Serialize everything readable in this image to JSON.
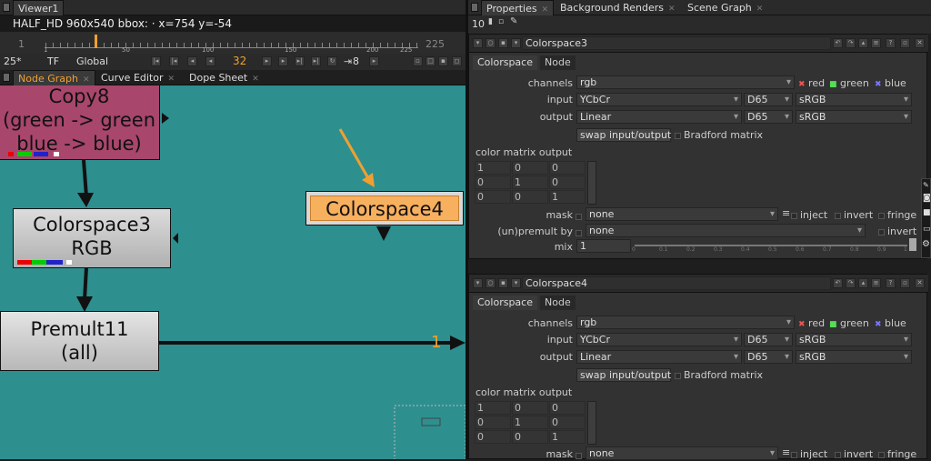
{
  "viewer": {
    "tab": "Viewer1",
    "info": "HALF_HD 960x540  bbox: · x=754 y=-54",
    "frame_start": "1",
    "frame_end": "225",
    "current_frame": "32",
    "ruler_ticks": [
      "1",
      "50",
      "100",
      "150",
      "200",
      "225"
    ],
    "zoom": "25*",
    "tf": "TF",
    "global": "Global",
    "step": "8"
  },
  "graph_tabs": [
    "Node Graph",
    "Curve Editor",
    "Dope Sheet"
  ],
  "nodes": {
    "copy8": {
      "line1": "Copy8",
      "line2": "(green -> green",
      "line3": "blue -> blue)"
    },
    "colorspace3": {
      "line1": "Colorspace3",
      "line2": "RGB"
    },
    "colorspace4": {
      "line1": "Colorspace4"
    },
    "premult11": {
      "line1": "Premult11",
      "line2": "(all)"
    }
  },
  "pipe_number": "1",
  "right_tabs": [
    "Properties",
    "Background Renders",
    "Scene Graph"
  ],
  "props_count": "10",
  "panels": [
    {
      "title": "Colorspace3",
      "subtabs": [
        "Colorspace",
        "Node"
      ],
      "channels_label": "channels",
      "channels_value": "rgb",
      "channel_flags": [
        "red",
        "green",
        "blue"
      ],
      "input_label": "input",
      "input_values": [
        "YCbCr",
        "D65",
        "sRGB"
      ],
      "output_label": "output",
      "output_values": [
        "Linear",
        "D65",
        "sRGB"
      ],
      "swap_button": "swap input/output",
      "bradford": "Bradford matrix",
      "matrix_label": "color matrix output",
      "matrix": [
        [
          "1",
          "0",
          "0"
        ],
        [
          "0",
          "1",
          "0"
        ],
        [
          "0",
          "0",
          "1"
        ]
      ],
      "mask_label": "mask",
      "mask_value": "none",
      "inject": "inject",
      "invert": "invert",
      "fringe": "fringe",
      "premult_label": "(un)premult by",
      "premult_value": "none",
      "premult_invert": "invert",
      "mix_label": "mix",
      "mix_value": "1",
      "mix_ticks": [
        "0",
        "0.1",
        "0.2",
        "0.3",
        "0.4",
        "0.5",
        "0.6",
        "0.7",
        "0.8",
        "0.9",
        "1"
      ]
    },
    {
      "title": "Colorspace4",
      "subtabs": [
        "Colorspace",
        "Node"
      ],
      "channels_label": "channels",
      "channels_value": "rgb",
      "channel_flags": [
        "red",
        "green",
        "blue"
      ],
      "input_label": "input",
      "input_values": [
        "YCbCr",
        "D65",
        "sRGB"
      ],
      "output_label": "output",
      "output_values": [
        "Linear",
        "D65",
        "sRGB"
      ],
      "swap_button": "swap input/output",
      "bradford": "Bradford matrix",
      "matrix_label": "color matrix output",
      "matrix": [
        [
          "1",
          "0",
          "0"
        ],
        [
          "0",
          "1",
          "0"
        ],
        [
          "0",
          "0",
          "1"
        ]
      ],
      "mask_label": "mask",
      "mask_value": "none",
      "inject": "inject",
      "invert": "invert",
      "fringe": "fringe"
    }
  ],
  "colors": {
    "graph_bg": "#2e8f8f",
    "copy_node": "#a8466b",
    "selected_node": "#f7b05e",
    "accent": "#f0a030"
  }
}
